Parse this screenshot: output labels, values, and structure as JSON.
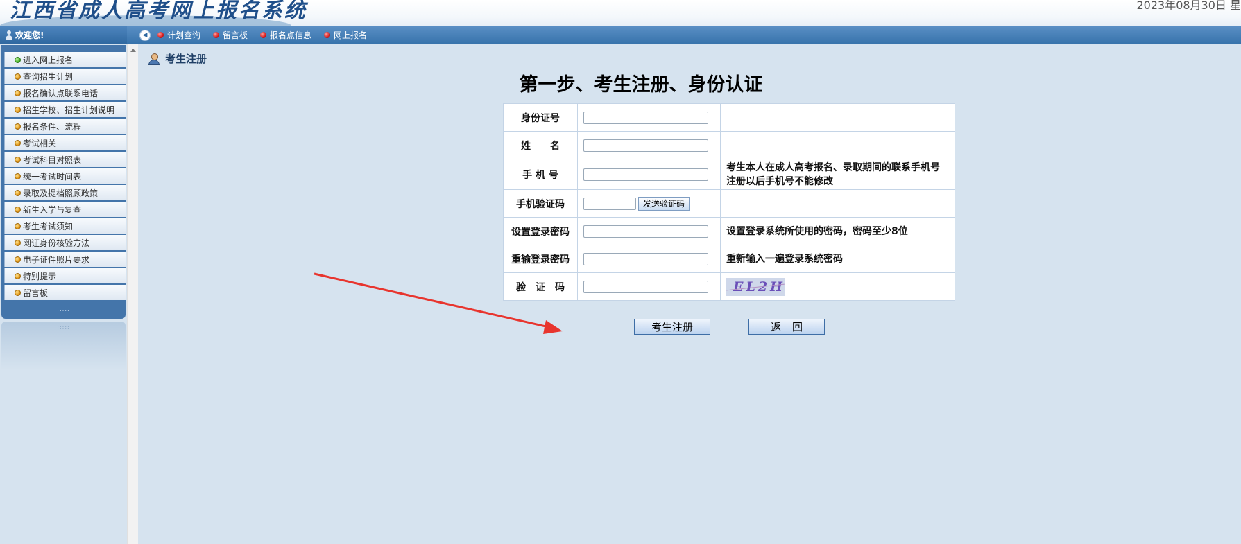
{
  "header": {
    "site_title": "江西省成人高考网上报名系统",
    "date_text": "2023年08月30日 星"
  },
  "sidebar": {
    "welcome": "欢迎您!",
    "items": [
      {
        "label": "进入网上报名",
        "dot": "green"
      },
      {
        "label": "查询招生计划",
        "dot": "orange"
      },
      {
        "label": "报名确认点联系电话",
        "dot": "orange"
      },
      {
        "label": "招生学校、招生计划说明",
        "dot": "orange"
      },
      {
        "label": "报名条件、流程",
        "dot": "orange"
      },
      {
        "label": "考试相关",
        "dot": "orange"
      },
      {
        "label": "考试科目对照表",
        "dot": "orange"
      },
      {
        "label": "统一考试时间表",
        "dot": "orange"
      },
      {
        "label": "录取及提档照顾政策",
        "dot": "orange"
      },
      {
        "label": "新生入学与复查",
        "dot": "orange"
      },
      {
        "label": "考生考试须知",
        "dot": "orange"
      },
      {
        "label": "网证身份核验方法",
        "dot": "orange"
      },
      {
        "label": "电子证件照片要求",
        "dot": "orange"
      },
      {
        "label": "特别提示",
        "dot": "orange"
      },
      {
        "label": "留言板",
        "dot": "orange"
      }
    ],
    "grip": ":::::"
  },
  "nav": {
    "links": [
      "计划查询",
      "留言板",
      "报名点信息",
      "网上报名"
    ]
  },
  "main": {
    "page_title": "考生注册",
    "step_heading": "第一步、考生注册、身份认证",
    "form": {
      "id_label": "身份证号",
      "name_label": "姓　　名",
      "phone_label": "手 机 号",
      "phone_desc_1": "考生本人在成人高考报名、录取期间的联系手机号",
      "phone_desc_2": "注册以后手机号不能修改",
      "sms_label": "手机验证码",
      "sms_button": "发送验证码",
      "pwd_label": "设置登录密码",
      "pwd_desc": "设置登录系统所使用的密码，密码至少8位",
      "pwd2_label": "重输登录密码",
      "pwd2_desc": "重新输入一遍登录系统密码",
      "captcha_label": "验　证　码",
      "captcha_text": "EL2H",
      "id_value": "",
      "name_value": "",
      "phone_value": "",
      "sms_value": "",
      "pwd_value": "",
      "pwd2_value": "",
      "captcha_value": ""
    },
    "register_button": "考生注册",
    "back_button": "返回"
  },
  "colors": {
    "nav_bar": "#3672ab",
    "page_bg": "#d6e3ef",
    "title_blue": "#1f4f8a",
    "annotation_arrow": "#e8352e"
  }
}
